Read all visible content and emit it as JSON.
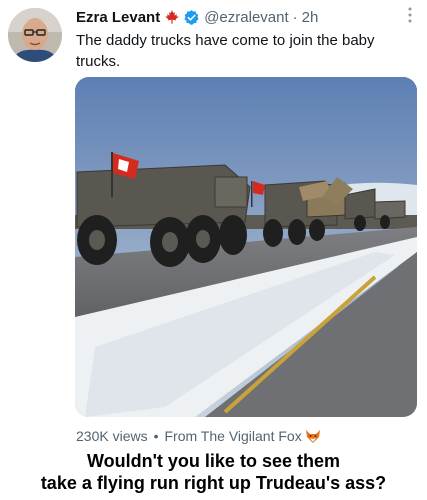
{
  "tweet": {
    "author_name": "Ezra Levant",
    "handle": "@ezralevant",
    "separator": "·",
    "time": "2h",
    "text": "The daddy trucks have come to join the baby trucks.",
    "icons": {
      "author": "maple-leaf-icon",
      "verified": "verified-badge-icon",
      "menu": "more-options-icon",
      "source": "fox-icon"
    }
  },
  "media": {
    "views": "230K views",
    "bullet": "•",
    "source": "From The Vigilant Fox"
  },
  "caption": {
    "line1": "Wouldn't you like to see them",
    "line2": "take a flying run right up Trudeau's ass?"
  },
  "colors": {
    "verified": "#1d9bf0",
    "leaf": "#d52b1e",
    "muted_text": "#536471"
  }
}
